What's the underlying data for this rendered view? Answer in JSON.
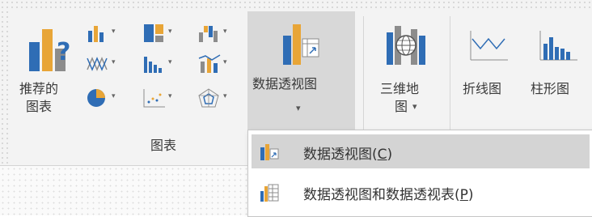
{
  "ribbon": {
    "recommended_charts": {
      "line1": "推荐的",
      "line2": "图表"
    },
    "pivot_chart": {
      "label": "数据透视图",
      "caret": "▾"
    },
    "map3d": {
      "line1": "三维地",
      "line2": "图",
      "caret": "▾"
    },
    "sparkline_line": {
      "label": "折线图"
    },
    "sparkline_column": {
      "label": "柱形图"
    },
    "group_label": "图表",
    "small_caret": "▾"
  },
  "menu": {
    "items": [
      {
        "text_pre": "数据透视图(",
        "key": "C",
        "text_post": ")"
      },
      {
        "text_pre": "数据透视图和数据透视表(",
        "key": "P",
        "text_post": ")"
      }
    ]
  },
  "colors": {
    "blue": "#2f6db5",
    "gold": "#e8a537",
    "gray": "#8c8c8c",
    "highlight": "#d4d4d4",
    "pressed": "#d8d8d8"
  }
}
